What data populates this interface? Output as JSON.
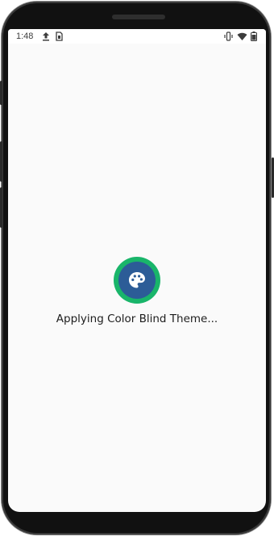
{
  "status_bar": {
    "time": "1:48",
    "left_icons": [
      "upload-icon",
      "sim-icon"
    ],
    "right_icons": [
      "vibrate-icon",
      "wifi-icon",
      "battery-icon"
    ]
  },
  "loading": {
    "icon": "palette-icon",
    "message": "Applying Color Blind Theme..."
  },
  "colors": {
    "ring": "#19b56a",
    "disc": "#2c5c97",
    "screen_background": "#fafafa"
  }
}
